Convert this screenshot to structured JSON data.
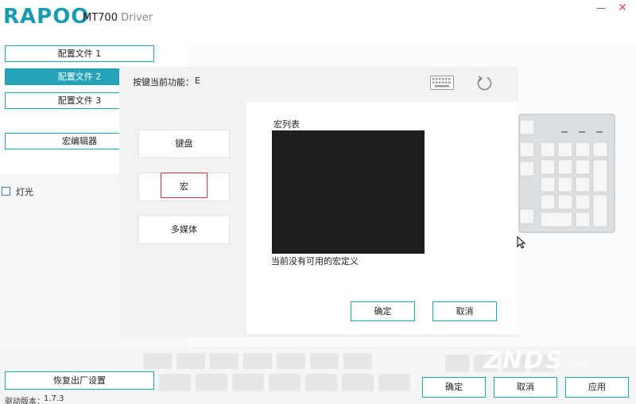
{
  "header": {
    "logo": "RAPOO",
    "model": "MT700",
    "subtitle": "Driver"
  },
  "window_controls": {
    "minimize_glyph": "—",
    "close_glyph": "✕"
  },
  "sidebar": {
    "profiles": [
      {
        "label": "配置文件 1",
        "active": false
      },
      {
        "label": "配置文件 2",
        "active": true
      },
      {
        "label": "配置文件 3",
        "active": false
      }
    ],
    "macro_editor": "宏编辑器",
    "light_label": "灯光"
  },
  "dialog": {
    "current_function_label": "按键当前功能：",
    "current_function_value": "E",
    "categories": [
      {
        "label": "键盘"
      },
      {
        "label": "宏",
        "selected": true
      },
      {
        "label": "多媒体"
      }
    ],
    "macro_list_label": "宏列表",
    "empty_message": "当前没有可用的宏定义",
    "ok": "确定",
    "cancel": "取消"
  },
  "footer": {
    "reset": "恢复出厂设置",
    "version_label": "驱动版本：",
    "version_value": "1.7.3",
    "confirm": "确定",
    "cancel": "取消",
    "apply": "应用"
  },
  "watermark": {
    "brand": "ZNDS",
    "suffix": ".com"
  },
  "colors": {
    "accent": "#27a3b8",
    "logo": "#1a9bb0",
    "selection_outline": "#d43c3c",
    "macro_list_bg": "#1e1e1e"
  }
}
